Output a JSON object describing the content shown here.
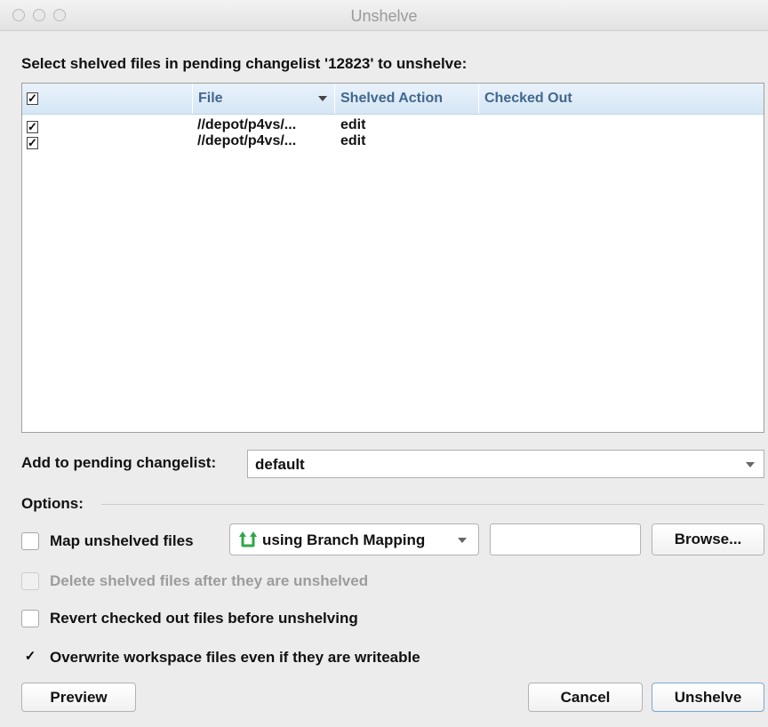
{
  "window": {
    "title": "Unshelve"
  },
  "prompt": "Select shelved files in pending changelist '12823' to unshelve:",
  "table": {
    "header_check": "✓",
    "columns": [
      "File",
      "Shelved Action",
      "Checked Out"
    ],
    "rows": [
      {
        "checked": "✓",
        "file": "//depot/p4vs/...",
        "action": "edit",
        "checked_out": ""
      },
      {
        "checked": "✓",
        "file": "//depot/p4vs/...",
        "action": "edit",
        "checked_out": ""
      }
    ]
  },
  "pending": {
    "label": "Add to pending changelist:",
    "value": "default"
  },
  "options": {
    "label": "Options:",
    "map": {
      "label": "Map unshelved files",
      "checked": "",
      "mapping": "using Branch Mapping",
      "path": "",
      "browse": "Browse..."
    },
    "delete": {
      "label": "Delete shelved files after they are unshelved",
      "checked": ""
    },
    "revert": {
      "label": "Revert checked out files before unshelving",
      "checked": ""
    },
    "overwrite": {
      "label": "Overwrite workspace files even if they are writeable",
      "checked": "✓"
    }
  },
  "buttons": {
    "preview": "Preview",
    "cancel": "Cancel",
    "unshelve": "Unshelve"
  },
  "colors": {
    "header_text": "#41678e",
    "branch_icon": "#2fa64a",
    "default_button_border": "#7aa7d8"
  }
}
